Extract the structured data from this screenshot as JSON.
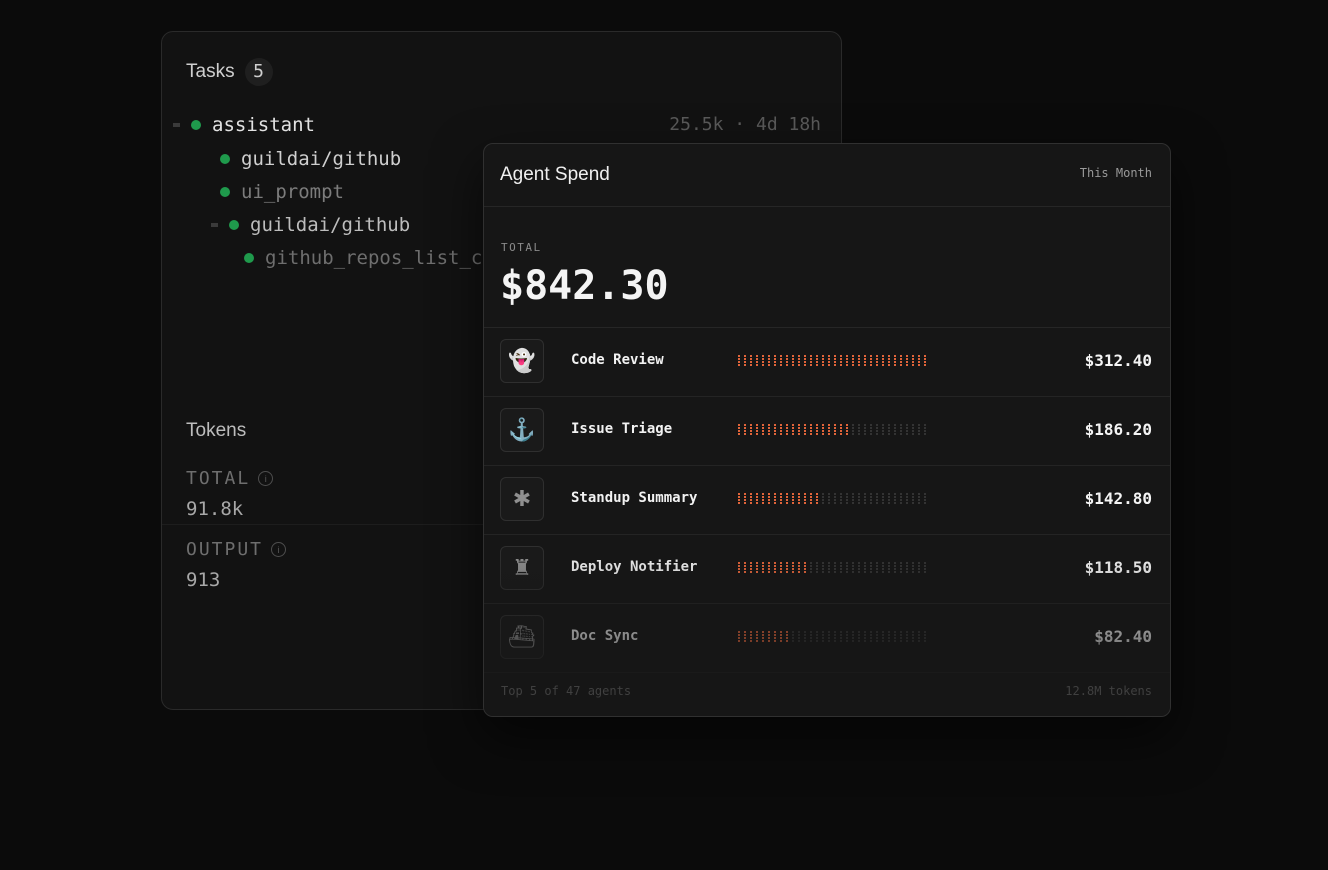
{
  "tasks": {
    "title": "Tasks",
    "count": "5",
    "tree": [
      {
        "label": "assistant",
        "level": 0,
        "collapse": true
      },
      {
        "label": "guildai/github",
        "level": 1,
        "collapse": false
      },
      {
        "label": "ui_prompt",
        "level": 1,
        "collapse": false
      },
      {
        "label": "guildai/github",
        "level": 1,
        "collapse": true
      },
      {
        "label": "github_repos_list_c",
        "level": 2,
        "collapse": false
      }
    ],
    "meta": "25.5k · 4d 18h"
  },
  "tokens": {
    "title": "Tokens",
    "total_label": "TOTAL",
    "total_value": "91.8k",
    "output_label": "OUTPUT",
    "output_value": "913"
  },
  "spend": {
    "title": "Agent Spend",
    "period": "This Month",
    "total_label": "TOTAL",
    "total_amount": "$842.30",
    "accent_color": "#e0643a",
    "agents": [
      {
        "name": "Code Review",
        "amount": "$312.40",
        "share": 1.0,
        "icon": "ghost-icon",
        "glyph": "👻"
      },
      {
        "name": "Issue Triage",
        "amount": "$186.20",
        "share": 0.6,
        "icon": "anchor-icon",
        "glyph": "⚓"
      },
      {
        "name": "Standup Summary",
        "amount": "$142.80",
        "share": 0.45,
        "icon": "bug-icon",
        "glyph": "✱"
      },
      {
        "name": "Deploy Notifier",
        "amount": "$118.50",
        "share": 0.37,
        "icon": "robot-icon",
        "glyph": "♜"
      },
      {
        "name": "Doc Sync",
        "amount": "$82.40",
        "share": 0.27,
        "icon": "ship-icon",
        "glyph": "⛴"
      }
    ],
    "footer_left": "Top 5 of 47 agents",
    "footer_right": "12.8M tokens"
  }
}
